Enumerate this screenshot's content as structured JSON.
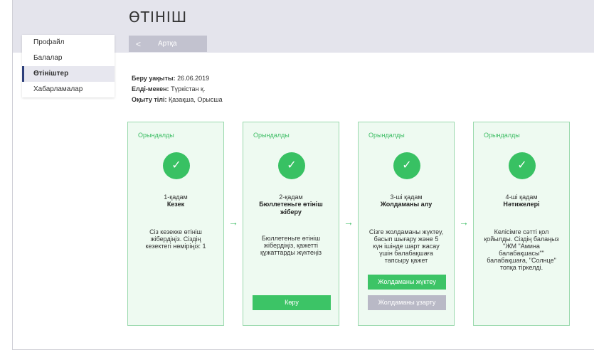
{
  "header": {
    "title": "ӨТІНІШ",
    "back_label": "Артқа",
    "back_chevron": "<"
  },
  "sidebar": {
    "items": [
      {
        "label": "Профайл",
        "active": false
      },
      {
        "label": "Балалар",
        "active": false
      },
      {
        "label": "Өтініштер",
        "active": true
      },
      {
        "label": "Хабарламалар",
        "active": false
      }
    ]
  },
  "info": {
    "date_label": "Беру уақыты:",
    "date_value": "26.06.2019",
    "locality_label": "Елді-мекен:",
    "locality_value": "Түркістан қ.",
    "language_label": "Оқыту тілі:",
    "language_value": "Қазақша, Орысша"
  },
  "colors": {
    "accent_green": "#3cc466",
    "card_border": "#9ad9ad",
    "card_bg": "#eefaf1",
    "header_bg": "#e4e4ec",
    "active_marker": "#2c3e7a"
  },
  "steps": [
    {
      "status": "Орындалды",
      "label": "1-қадам",
      "title": "Кезек",
      "desc_lines": [
        "Сіз кезекке өтініш",
        "жібердіңіз. Сіздің",
        "кезектегі нөміріңіз: 1"
      ],
      "buttons": []
    },
    {
      "status": "Орындалды",
      "label": "2-қадам",
      "title_lines": [
        "Бюллетеньге өтініш",
        "жіберу"
      ],
      "desc_lines": [
        "Бюллетеньге өтініш",
        "жібердіңіз, қажетті",
        "құжаттарды жүктеңіз"
      ],
      "buttons": [
        {
          "label": "Көру",
          "style": "green"
        }
      ]
    },
    {
      "status": "Орындалды",
      "label": "3-ші қадам",
      "title": "Жолдаманы алу",
      "desc_lines": [
        "Сізге жолдаманы жүктеу,",
        "басып шығару және 5",
        "күн ішінде шарт жасау",
        "үшін балабақшаға",
        "тапсыру қажет"
      ],
      "buttons": [
        {
          "label": "Жолдаманы жүктеу",
          "style": "green"
        },
        {
          "label": "Жолдаманы ұзарту",
          "style": "gray"
        }
      ]
    },
    {
      "status": "Орындалды",
      "label": "4-ші қадам",
      "title": "Нәтижелері",
      "desc_lines": [
        "Келісімге сәтті қол",
        "қойылды. Сіздің балаңыз",
        "\"ЖМ \"Амина",
        "балабақшасы\"\"",
        "балабақшаға, \"Солнце\"",
        "топқа тіркелді."
      ],
      "buttons": []
    }
  ],
  "icons": {
    "check": "✓",
    "arrow": "→"
  }
}
